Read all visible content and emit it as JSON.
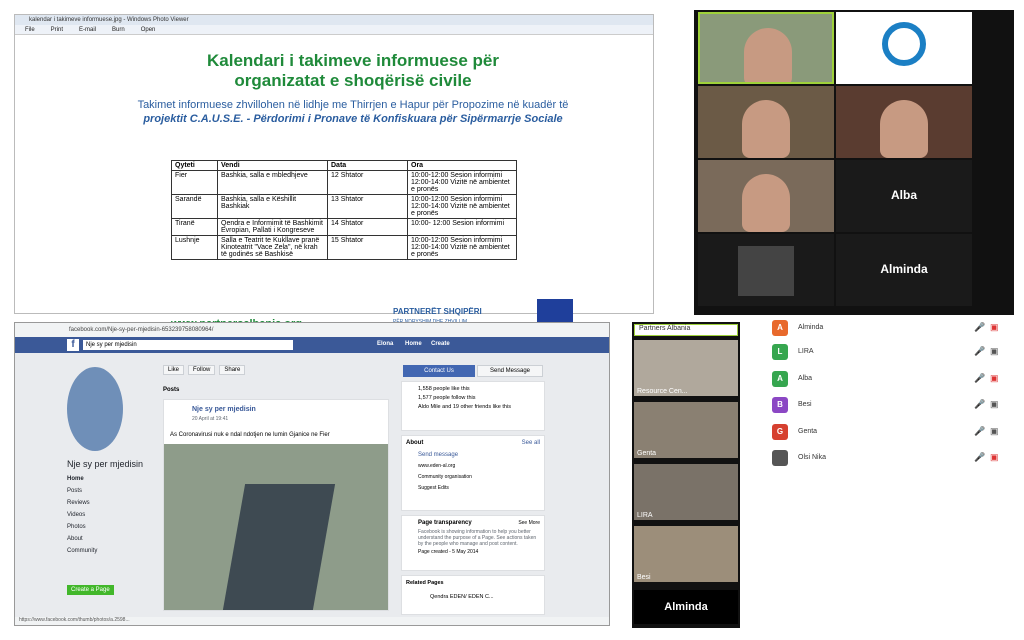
{
  "viewer": {
    "title": "kalendar i takimeve informuese.jpg - Windows Photo Viewer",
    "menu": [
      "File",
      "Print",
      "E-mail",
      "Burn",
      "Open"
    ]
  },
  "doc": {
    "title1": "Kalendari i takimeve informuese për",
    "title2": "organizatat e shoqërisë civile",
    "sub1": "Takimet informuese zhvillohen në lidhje me Thirrjen e Hapur për Propozime në kuadër të",
    "sub2": "projektit C.A.U.S.E. - Përdorimi i Pronave të Konfiskuara për Sipërmarrje Sociale",
    "headers": [
      "Qyteti",
      "Vendi",
      "Data",
      "Ora"
    ],
    "rows": [
      [
        "Fier",
        "Bashkia, salla e mbledhjeve",
        "12 Shtator",
        "10:00-12:00 Sesion informimi 12:00-14:00 Vizitë në ambientet e pronës"
      ],
      [
        "Sarandë",
        "Bashkia, salla e Këshillit Bashkiak",
        "13 Shtator",
        "10:00-12:00 Sesion informimi 12:00-14:00 Vizitë në ambientet e pronës"
      ],
      [
        "Tiranë",
        "Qendra e Informimit të Bashkimit Evropian, Pallati i Kongreseve",
        "14 Shtator",
        "10:00- 12:00 Sesion informimi"
      ],
      [
        "Lushnje",
        "Salla e Teatrit te Kukllave pranë Kinoteatrit \"Vace Zela\", në krah të godinës së Bashkisë",
        "15 Shtator",
        "10:00-12:00 Sesion informimi 12:00-14:00 Vizitë në ambientet e pronës"
      ]
    ],
    "url": "www.partnersalbania.org",
    "logo_text": "PARTNERËT SHQIPËRI",
    "logo_sub": "PËR NDRYSHIM DHE ZHVILLIM"
  },
  "grid": {
    "names": [
      "Alba",
      "Alminda"
    ]
  },
  "fb": {
    "url": "facebook.com/Nje-sy-per-mjedisin-653239758080964/",
    "search": "Nje sy per mjedisin",
    "nav": [
      "Elona",
      "Home",
      "Create"
    ],
    "page_name": "Nje sy per mjedisin",
    "side": [
      "Home",
      "Posts",
      "Reviews",
      "Videos",
      "Photos",
      "About",
      "Community"
    ],
    "create_page": "Create a Page",
    "actions": [
      "Like",
      "Follow",
      "Share"
    ],
    "posts_label": "Posts",
    "post_author": "Nje sy per mjedisin",
    "post_date": "20 April at 19:41",
    "post_text": "As Coronavirusi nuk e ndal ndotjen ne lumin Gjanice ne Fier",
    "contact": "Contact Us",
    "send": "Send Message",
    "stats": [
      "1,558 people like this",
      "1,577 people follow this",
      "Aldo Mile and 19 other friends like this"
    ],
    "about_title": "About",
    "see_all": "See all",
    "about": [
      "Send message",
      "www.eden-al.org",
      "Community organisation",
      "Suggest Edits"
    ],
    "transp_title": "Page transparency",
    "see_more": "See More",
    "transp_text": "Facebook is showing information to help you better understand the purpose of a Page. See actions taken by the people who manage and post content.",
    "created": "Page created - 5 May 2014",
    "related": "Related Pages",
    "related_item": "Qendra EDEN/ EDEN C...",
    "status": "https://www.facebook.com/thumb/photos/a.2598..."
  },
  "strip": {
    "top": "Partners Albania",
    "labels": [
      "Resource Cen...",
      "Genta",
      "LIRA",
      "Besi"
    ],
    "bottom": "Alminda"
  },
  "participants": [
    {
      "letter": "A",
      "name": "Alminda",
      "color": "#e8692c"
    },
    {
      "letter": "L",
      "name": "LIRA",
      "color": "#36a64f"
    },
    {
      "letter": "A",
      "name": "Alba",
      "color": "#36a64f"
    },
    {
      "letter": "B",
      "name": "Besi",
      "color": "#8b47c4"
    },
    {
      "letter": "G",
      "name": "Genta",
      "color": "#d6402f"
    },
    {
      "letter": "",
      "name": "Olsi Nika",
      "color": "#555555"
    }
  ]
}
